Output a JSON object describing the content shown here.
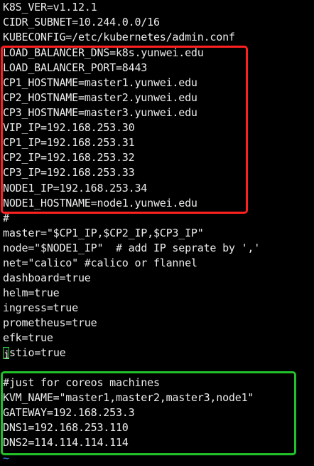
{
  "colors": {
    "background": "#000000",
    "text": "#ececec",
    "highlight_red": "#ff2020",
    "highlight_green": "#22c02a",
    "tilde": "#3a7fe0"
  },
  "lines": [
    "K8S_VER=v1.12.1",
    "CIDR_SUBNET=10.244.0.0/16",
    "KUBECONFIG=/etc/kubernetes/admin.conf",
    "LOAD_BALANCER_DNS=k8s.yunwei.edu",
    "LOAD_BALANCER_PORT=8443",
    "CP1_HOSTNAME=master1.yunwei.edu",
    "CP2_HOSTNAME=master2.yunwei.edu",
    "CP3_HOSTNAME=master3.yunwei.edu",
    "VIP_IP=192.168.253.30",
    "CP1_IP=192.168.253.31",
    "CP2_IP=192.168.253.32",
    "CP3_IP=192.168.253.33",
    "NODE1_IP=192.168.253.34",
    "NODE1_HOSTNAME=node1.yunwei.edu",
    "#",
    "master=\"$CP1_IP,$CP2_IP,$CP3_IP\"",
    "node=\"$NODE1_IP\"  # add IP seprate by ','",
    "net=\"calico\" #calico or flannel",
    "dashboard=true",
    "helm=true",
    "ingress=true",
    "prometheus=true",
    "efk=true",
    "stio=true",
    "",
    "#just for coreos machines",
    "KVM_NAME=\"master1,master2,master3,node1\"",
    "GATEWAY=192.168.253.3",
    "DNS1=192.168.253.110",
    "DNS2=114.114.114.114",
    "~"
  ],
  "cursor_char": "i"
}
